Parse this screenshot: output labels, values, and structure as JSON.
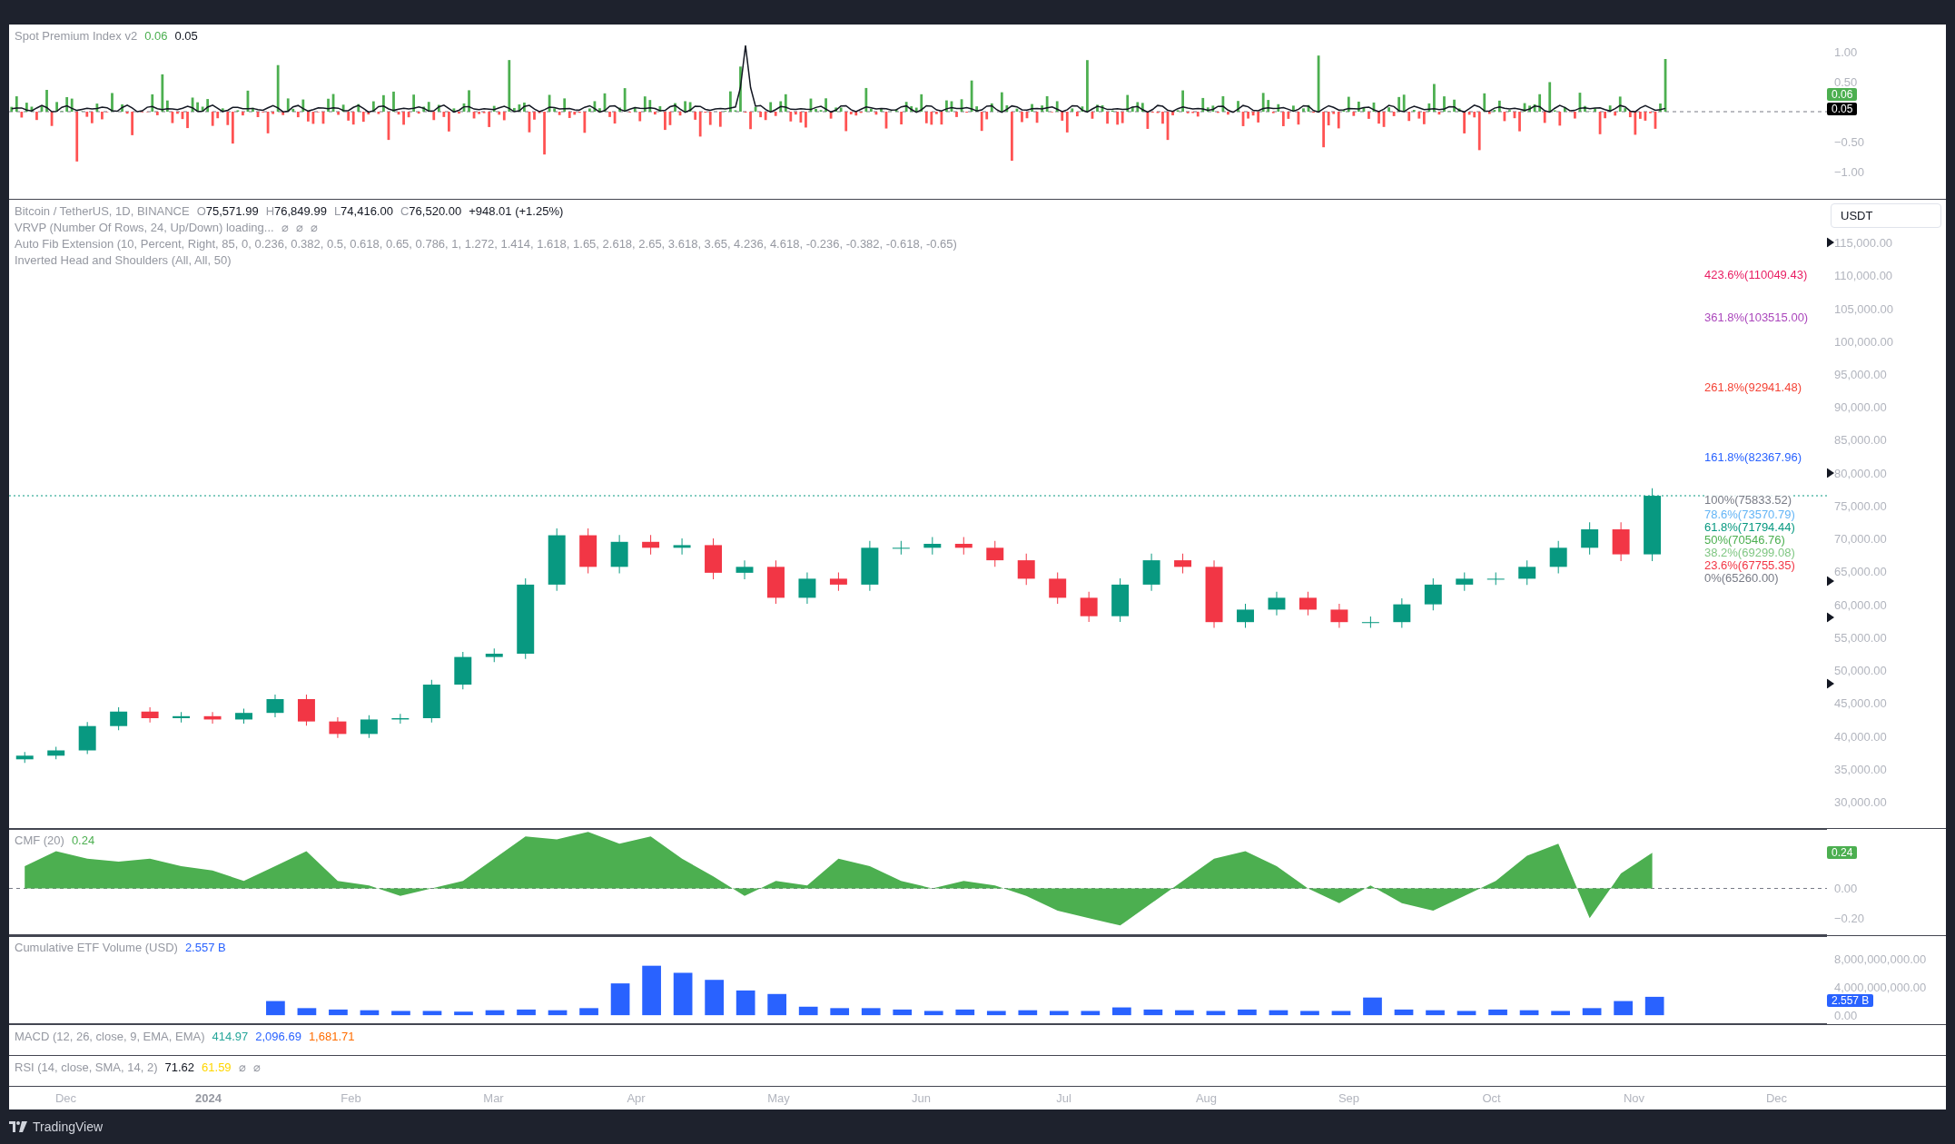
{
  "spot_pane": {
    "title": "Spot Premium Index v2",
    "values": [
      {
        "text": "0.06",
        "color": "#4caf50"
      },
      {
        "text": "0.05",
        "color": "#131722"
      }
    ],
    "badges": [
      {
        "text": "0.06",
        "color": "#4caf50"
      },
      {
        "text": "0.05",
        "color": "#000000"
      }
    ],
    "y_axis": [
      "1.00",
      "0.50",
      "−0.50",
      "−1.00"
    ]
  },
  "price_pane": {
    "symbol": "Bitcoin / TetherUS, 1D, BINANCE",
    "ohlc": [
      {
        "label": "O",
        "value": "75,571.99"
      },
      {
        "label": "H",
        "value": "76,849.99"
      },
      {
        "label": "L",
        "value": "74,416.00"
      },
      {
        "label": "C",
        "value": "76,520.00"
      }
    ],
    "change": "+948.01 (+1.25%)",
    "indicators": [
      {
        "text": "VRVP (Number Of Rows, 24, Up/Down) loading...",
        "extras": [
          "⌀",
          "⌀",
          "⌀"
        ]
      },
      {
        "text": "Auto Fib Extension (10, Percent, Right, 85, 0, 0.236, 0.382, 0.5, 0.618, 0.65, 0.786, 1, 1.272, 1.414, 1.618, 1.65, 2.618, 2.65, 3.618, 3.65, 4.236, 4.618, -0.236, -0.382, -0.618, -0.65)"
      },
      {
        "text": "Inverted Head and Shoulders (All, All, 50)"
      }
    ],
    "currency": "USDT",
    "fib_levels": [
      {
        "text": "423.6%(110049.43)",
        "color": "#e91e63"
      },
      {
        "text": "361.8%(103515.00)",
        "color": "#ab47bc"
      },
      {
        "text": "261.8%(92941.48)",
        "color": "#f44336"
      },
      {
        "text": "161.8%(82367.96)",
        "color": "#2962ff"
      },
      {
        "text": "100%(75833.52)",
        "color": "#787b86"
      },
      {
        "text": "78.6%(73570.79)",
        "color": "#64b5f6"
      },
      {
        "text": "61.8%(71794.44)",
        "color": "#089981"
      },
      {
        "text": "50%(70546.76)",
        "color": "#4caf50"
      },
      {
        "text": "38.2%(69299.08)",
        "color": "#81c784"
      },
      {
        "text": "23.6%(67755.35)",
        "color": "#f23645"
      },
      {
        "text": "0%(65260.00)",
        "color": "#787b86"
      }
    ],
    "y_axis": [
      "115,000.00",
      "110,000.00",
      "105,000.00",
      "100,000.00",
      "95,000.00",
      "90,000.00",
      "85,000.00",
      "80,000.00",
      "75,000.00",
      "70,000.00",
      "65,000.00",
      "60,000.00",
      "55,000.00",
      "50,000.00",
      "45,000.00",
      "40,000.00",
      "35,000.00",
      "30,000.00"
    ]
  },
  "cmf_pane": {
    "title": "CMF (20)",
    "values": [
      {
        "text": "0.24",
        "color": "#4caf50"
      }
    ],
    "badge": {
      "text": "0.24",
      "color": "#4caf50"
    },
    "chart_data": {
      "type": "area",
      "ylim": [
        -0.315,
        0.4
      ],
      "yticks": [
        {
          "value": 0,
          "label": "0.00"
        },
        {
          "value": -0.2,
          "label": "−0.20"
        }
      ],
      "categories": [
        null,
        null,
        null,
        null,
        null,
        null,
        null,
        null,
        null,
        null,
        null,
        null,
        null,
        null,
        null,
        null,
        null,
        null,
        null,
        null,
        null,
        null,
        null,
        null,
        null,
        null,
        null,
        null,
        null,
        null,
        null,
        null,
        null,
        null,
        null,
        null,
        null,
        null,
        null,
        null,
        null,
        null,
        null,
        null,
        null,
        null,
        null,
        null,
        null,
        null,
        null,
        null,
        null
      ],
      "series": [
        {
          "color": "#4caf50",
          "values": [
            0.15,
            0.25,
            0.2,
            0.18,
            0.2,
            0.15,
            0.12,
            0.05,
            0.15,
            0.25,
            0.05,
            0.02,
            -0.05,
            0.0,
            0.05,
            0.2,
            0.35,
            0.33,
            0.38,
            0.3,
            0.35,
            0.2,
            0.08,
            -0.05,
            0.05,
            0.02,
            0.2,
            0.15,
            0.05,
            0.0,
            0.05,
            0.02,
            -0.05,
            -0.15,
            -0.2,
            -0.25,
            -0.1,
            0.05,
            0.2,
            0.25,
            0.15,
            0.0,
            -0.1,
            0.02,
            -0.1,
            -0.15,
            -0.05,
            0.05,
            0.22,
            0.3,
            -0.2,
            0.1,
            0.24
          ]
        }
      ]
    }
  },
  "etf_pane": {
    "title": "Cumulative ETF Volume (USD)",
    "values": [
      {
        "text": "2.557 B",
        "color": "#2962ff"
      }
    ],
    "badge": {
      "text": "2.557 B",
      "color": "#2962ff"
    },
    "chart_data": {
      "type": "bar",
      "ylim": [
        -1270000000,
        11200000000
      ],
      "yticks": [
        {
          "value": 8000000000,
          "label": "8,000,000,000.00"
        },
        {
          "value": 4000000000,
          "label": "4,000,000,000.00"
        },
        {
          "value": 0,
          "label": "0.00"
        }
      ],
      "categories": [
        null,
        null,
        null,
        null,
        null,
        null,
        null,
        null,
        null,
        null,
        null,
        null,
        null,
        null,
        null,
        null,
        null,
        null,
        null,
        null,
        null,
        null,
        null,
        null,
        null,
        null,
        null,
        null,
        null,
        null,
        null,
        null,
        null,
        null,
        null,
        null,
        null,
        null,
        null,
        null,
        null,
        null,
        null,
        null,
        null,
        null,
        null,
        null,
        null,
        null,
        null,
        null,
        null,
        null,
        null,
        null,
        null,
        null
      ],
      "series": [
        {
          "color": "#2962ff",
          "values": [
            null,
            null,
            null,
            null,
            null,
            null,
            null,
            null,
            2000000000,
            1000000000,
            800000000,
            700000000,
            600000000,
            600000000,
            500000000,
            700000000,
            800000000,
            700000000,
            1000000000,
            4500000000,
            7000000000,
            6000000000,
            5000000000,
            3500000000,
            3000000000,
            1200000000,
            1000000000,
            1000000000,
            800000000,
            600000000,
            800000000,
            600000000,
            700000000,
            600000000,
            600000000,
            1100000000,
            800000000,
            700000000,
            600000000,
            800000000,
            700000000,
            600000000,
            600000000,
            2500000000,
            800000000,
            700000000,
            600000000,
            800000000,
            700000000,
            600000000,
            1000000000,
            2000000000,
            2600000000,
            null,
            null,
            null,
            null,
            null
          ]
        }
      ]
    }
  },
  "macd_pane": {
    "title": "MACD (12, 26, close, 9, EMA, EMA)",
    "values": [
      {
        "text": "414.97",
        "color": "#26a69a"
      },
      {
        "text": "2,096.69",
        "color": "#2962ff"
      },
      {
        "text": "1,681.71",
        "color": "#ff6d00"
      }
    ]
  },
  "rsi_pane": {
    "title": "RSI (14, close, SMA, 14, 2)",
    "values": [
      {
        "text": "71.62",
        "color": "#131722"
      },
      {
        "text": "61.59",
        "color": "#ffd600"
      }
    ],
    "extras": [
      "⌀",
      "⌀"
    ]
  },
  "time_axis": [
    {
      "label": "Dec",
      "bold": false
    },
    {
      "label": "2024",
      "bold": true
    },
    {
      "label": "Feb",
      "bold": false
    },
    {
      "label": "Mar",
      "bold": false
    },
    {
      "label": "Apr",
      "bold": false
    },
    {
      "label": "May",
      "bold": false
    },
    {
      "label": "Jun",
      "bold": false
    },
    {
      "label": "Jul",
      "bold": false
    },
    {
      "label": "Aug",
      "bold": false
    },
    {
      "label": "Sep",
      "bold": false
    },
    {
      "label": "Oct",
      "bold": false
    },
    {
      "label": "Nov",
      "bold": false
    },
    {
      "label": "Dec",
      "bold": false
    }
  ],
  "footer": {
    "brand": "TradingView"
  }
}
